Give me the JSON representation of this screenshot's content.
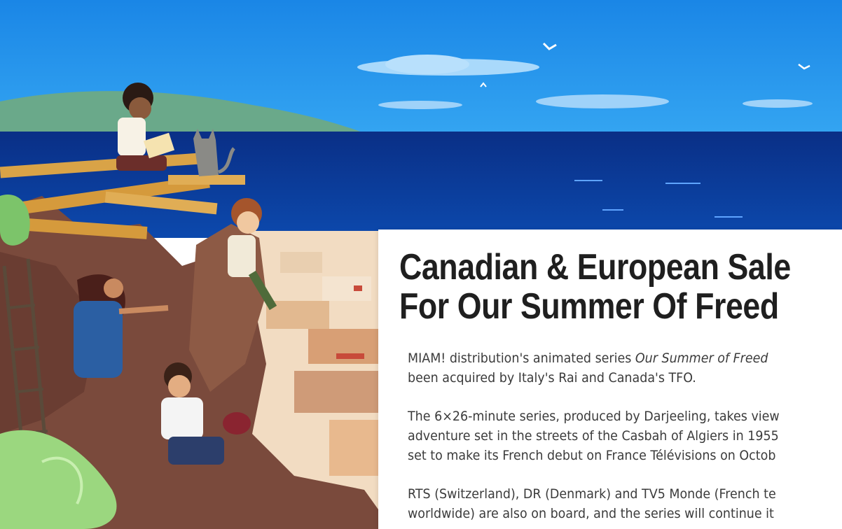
{
  "article": {
    "headline_line1": "Canadian & European Sale",
    "headline_line2": "For Our Summer Of Freed",
    "p1": {
      "line1_prefix": "MIAM! distribution's animated series ",
      "line1_title": "Our Summer of Freed",
      "line2": "been acquired by Italy's Rai and Canada's TFO."
    },
    "p2": {
      "line1": "The 6×26-minute series, produced by Darjeeling, takes view",
      "line2": "adventure set in the streets of the Casbah of Algiers in 1955",
      "line3": "set to make its French debut on France Télévisions on Octob"
    },
    "p3": {
      "line1": "RTS (Switzerland), DR (Denmark) and TV5 Monde (French te",
      "line2": "worldwide) are also on board, and the series will continue it"
    }
  },
  "hero_image": {
    "alt": "Illustration of children climbing rocks above a seaside town",
    "colors": {
      "sky": "#1e90e8",
      "sea": "#0b3f9e",
      "hill": "#6aa98a",
      "rock": "#7a4a3c",
      "plank": "#d9a347"
    }
  }
}
